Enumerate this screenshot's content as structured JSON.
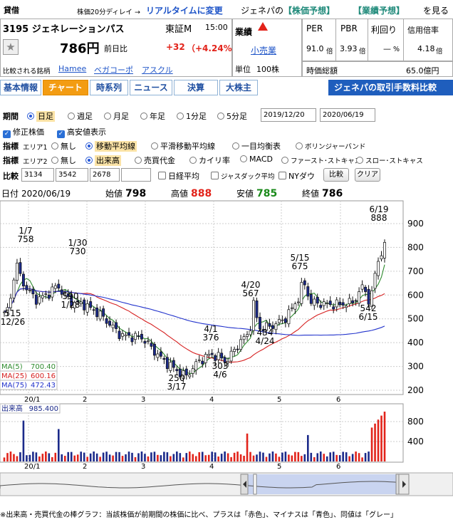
{
  "header": {
    "tag": "貸借",
    "delay_note": "株価20分ディレイ →",
    "realtime_link": "リアルタイムに変更",
    "forecast_prefix": "ジェネパの",
    "forecast_link1": "【株価予想】",
    "forecast_link2": "【業績予想】",
    "forecast_suffix": "を見る",
    "code_name": "3195 ジェネレーションパス",
    "market": "東証M",
    "time": "15:00",
    "price": "786円",
    "change_label": "前日比",
    "change": "+32",
    "change_pct": "（+4.24%）",
    "compare_label": "比較される銘柄",
    "compare_links": [
      "Hamee",
      "ベガコーポ",
      "アスクル"
    ],
    "industry_label": "業績",
    "industry": "小売業",
    "unit_label": "単位",
    "unit": "100株",
    "metrics": [
      {
        "label": "PER",
        "value": "91.0",
        "unit": "倍"
      },
      {
        "label": "PBR",
        "value": "3.93",
        "unit": "倍"
      },
      {
        "label": "利回り",
        "value": "—",
        "unit": "%"
      },
      {
        "label": "信用倍率",
        "value": "4.18",
        "unit": "倍"
      }
    ],
    "mcap_label": "時価総額",
    "mcap": "65.0億円"
  },
  "tabs": [
    "基本情報",
    "チャート",
    "時系列",
    "ニュース",
    "決算",
    "大株主"
  ],
  "banner": "ジェネパの取引手数料比較",
  "controls": {
    "period_label": "期間",
    "periods": [
      "日足",
      "週足",
      "月足",
      "年足",
      "1分足",
      "5分足"
    ],
    "date_from": "2019/12/20",
    "date_to": "2020/06/19",
    "adj_label": "修正株価",
    "hl_label": "高安値表示",
    "ind_label": "指標",
    "area1": "エリア1",
    "area1_opts": [
      "無し",
      "移動平均線",
      "平滑移動平均線",
      "一目均衡表",
      "ボリンジャーバンド"
    ],
    "area2": "エリア2",
    "area2_opts": [
      "無し",
      "出来高",
      "売買代金",
      "カイリ率",
      "MACD",
      "ファースト･ストキャス",
      "スロー･ストキャス"
    ],
    "cmp_label": "比較",
    "cmp_codes": [
      "3134",
      "3542",
      "2678",
      ""
    ],
    "cmp_checks": [
      "日経平均",
      "ジャスダック平均",
      "NYダウ"
    ],
    "cmp_btn": "比較",
    "clear_btn": "クリア"
  },
  "chart_info": {
    "date_label": "日付",
    "date": "2020/06/19",
    "open_label": "始値",
    "open": "798",
    "high_label": "高値",
    "high": "888",
    "low_label": "安値",
    "low": "785",
    "close_label": "終値",
    "close": "786"
  },
  "chart_data": {
    "type": "candlestick",
    "price_ticks": [
      200,
      300,
      400,
      500,
      600,
      700,
      800,
      900
    ],
    "x_ticks": [
      "20/1",
      "2",
      "3",
      "4",
      "5",
      "6"
    ],
    "ma_legend": [
      {
        "name": "MA(5)",
        "value": "700.40",
        "color": "#2e8b2e"
      },
      {
        "name": "MA(25)",
        "value": "600.16",
        "color": "#d62020"
      },
      {
        "name": "MA(75)",
        "value": "472.43",
        "color": "#2233cc"
      }
    ],
    "annotations": [
      {
        "label": "1/7",
        "value": "758"
      },
      {
        "label": "1/30",
        "value": "730"
      },
      {
        "label": "515",
        "value": "12/26"
      },
      {
        "label": "590",
        "value": "1/28"
      },
      {
        "label": "250",
        "value": "3/17"
      },
      {
        "label": "4/1",
        "value": "376"
      },
      {
        "label": "303",
        "value": "4/6"
      },
      {
        "label": "4/20",
        "value": "567"
      },
      {
        "label": "434",
        "value": "4/24"
      },
      {
        "label": "5/15",
        "value": "675"
      },
      {
        "label": "542",
        "value": "6/15"
      },
      {
        "label": "6/19",
        "value": "888"
      }
    ],
    "volume_label": "出来高",
    "volume_value": "985.400",
    "volume_ticks": [
      400,
      800
    ],
    "nav_labels": [
      "5",
      "7",
      "9",
      "11",
      "20/1",
      "3",
      "5"
    ]
  },
  "footer": "※出来高・売買代金の棒グラフ：当該株価が前期間の株価に比べ、プラスは「赤色」、マイナスは「青色」、同値は「グレー」"
}
